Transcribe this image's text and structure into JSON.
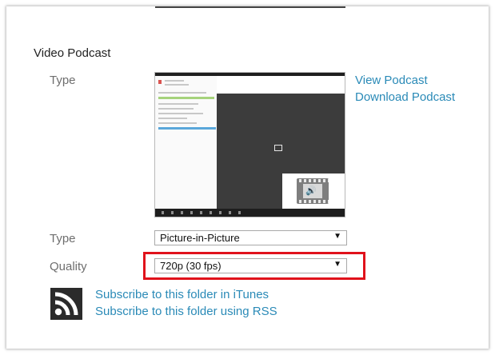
{
  "section_title": "Video Podcast",
  "preview": {
    "type_label": "Type",
    "view_link": "View Podcast",
    "download_link": "Download Podcast",
    "thumbnail_icon": "video-thumbnail"
  },
  "type_select": {
    "label": "Type",
    "value": "Picture-in-Picture",
    "arrow_icon": "dropdown-arrow-icon"
  },
  "quality_select": {
    "label": "Quality",
    "value": "720p (30 fps)",
    "arrow_icon": "dropdown-arrow-icon"
  },
  "subscribe": {
    "icon": "rss-icon",
    "itunes_link": "Subscribe to this folder in iTunes",
    "rss_link": "Subscribe to this folder using RSS"
  },
  "colors": {
    "link": "#2a8ab7",
    "highlight": "#e0121b",
    "label": "#6e6e6e"
  }
}
